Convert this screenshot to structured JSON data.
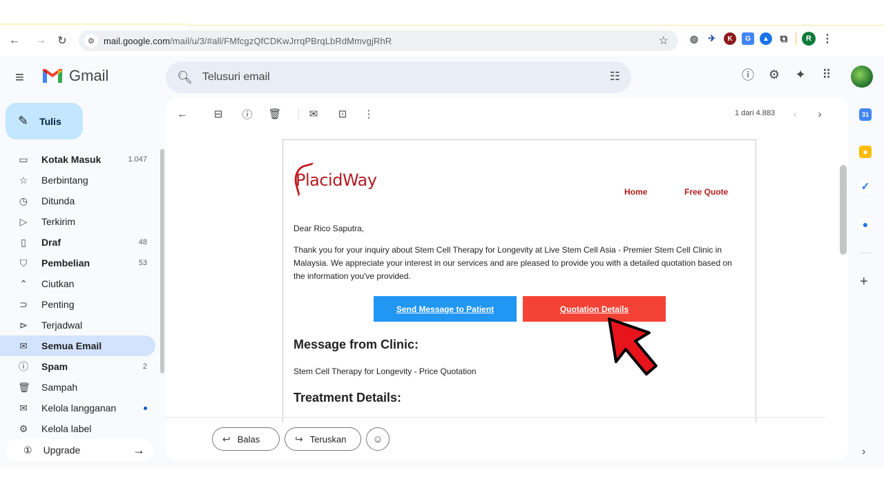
{
  "browser": {
    "url_domain": "mail.google.com",
    "url_path": "/mail/u/3/#all/FMfcgzQfCDKwJrrqPBrqLbRdMmvgjRhR",
    "profile_initial": "R",
    "extension_k": "K"
  },
  "gmail": {
    "logo_text": "Gmail",
    "search_placeholder": "Telusuri email",
    "compose_label": "Tulis",
    "nav": [
      {
        "label": "Kotak Masuk",
        "count": "1.047",
        "bold": true
      },
      {
        "label": "Berbintang",
        "count": ""
      },
      {
        "label": "Ditunda",
        "count": ""
      },
      {
        "label": "Terkirim",
        "count": ""
      },
      {
        "label": "Draf",
        "count": "48",
        "bold": true
      },
      {
        "label": "Pembelian",
        "count": "53",
        "bold": true
      },
      {
        "label": "Ciutkan",
        "count": ""
      },
      {
        "label": "Penting",
        "count": ""
      },
      {
        "label": "Terjadwal",
        "count": ""
      },
      {
        "label": "Semua Email",
        "count": "",
        "bold": true
      },
      {
        "label": "Spam",
        "count": "2",
        "bold": true
      },
      {
        "label": "Sampah",
        "count": ""
      },
      {
        "label": "Kelola langganan",
        "count": ""
      },
      {
        "label": "Kelola label",
        "count": ""
      }
    ],
    "upgrade_label": "Upgrade",
    "counter": "1 dari 4.883"
  },
  "email": {
    "logo_text": "PlacidWay",
    "nav_home": "Home",
    "nav_quote": "Free Quote",
    "greeting": "Dear Rico Saputra,",
    "body": "Thank you for your inquiry about Stem Cell Therapy for Longevity at Live Stem Cell Asia - Premier Stem Cell Clinic in Malaysia. We appreciate your interest in our services and are pleased to provide you with a detailed quotation based on the information you've provided.",
    "btn_message": "Send Message to Patient",
    "btn_quote": "Quotation Details",
    "heading_clinic": "Message from Clinic:",
    "subject_line": "Stem Cell Therapy for Longevity - Price Quotation",
    "heading_treatment": "Treatment Details:"
  },
  "reply": {
    "reply_label": "Balas",
    "forward_label": "Teruskan"
  },
  "colors": {
    "accent_blue": "#2196f3",
    "accent_red": "#f44336",
    "brand_red": "#b31b23"
  }
}
